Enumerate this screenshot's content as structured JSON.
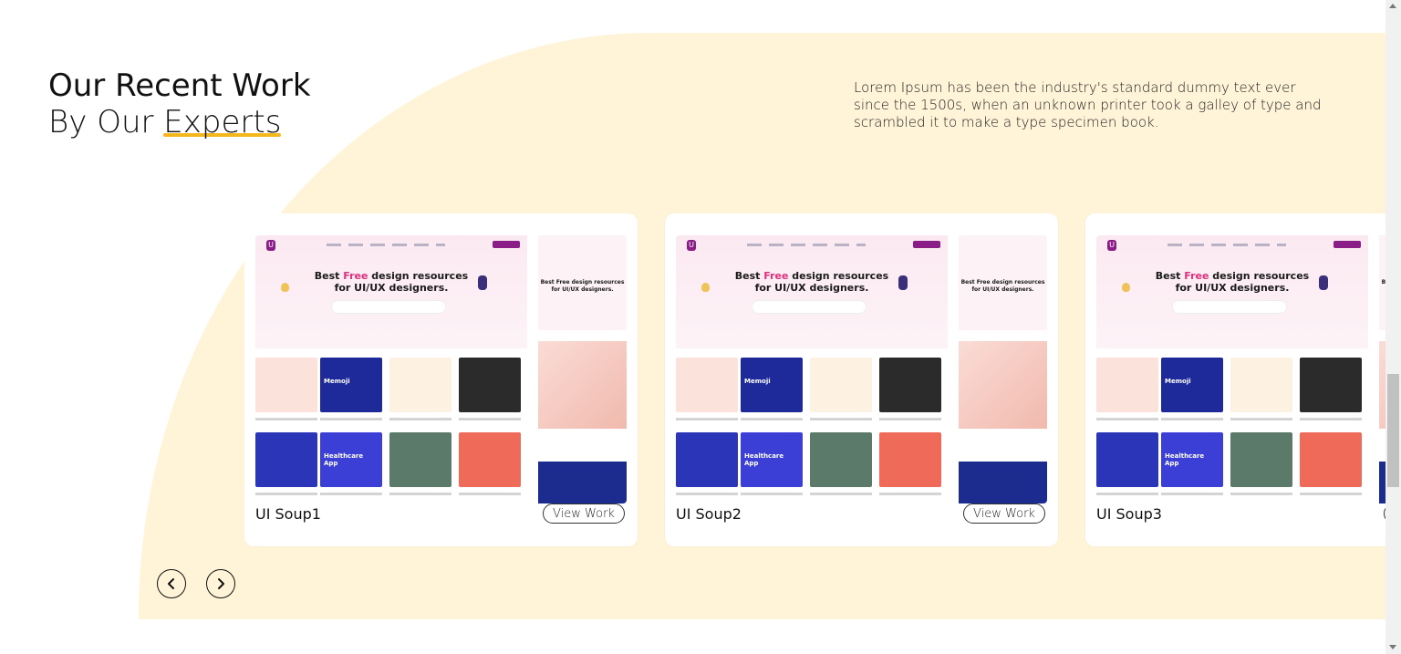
{
  "section": {
    "heading_line1": "Our Recent Work",
    "heading_line2_prefix": "By Our ",
    "heading_line2_accent": "Experts",
    "description": "Lorem Ipsum has been the industry's standard dummy text ever since the 1500s, when an unknown printer took a galley of type and scrambled it to make a type specimen book."
  },
  "colors": {
    "accent_yellow": "#f5b81c",
    "panel_background": "#fff4d8",
    "brand_purple": "#8a1e86",
    "pink_highlight": "#e0307d"
  },
  "preview": {
    "hero_title_before": "Best ",
    "hero_title_highlight": "Free",
    "hero_title_after": " design resources for UI/UX designers.",
    "side_title": "Best Free design resources for UI/UX designers.",
    "tiles": [
      {
        "label": "",
        "color": "#fbe3dc"
      },
      {
        "label": "Memoji",
        "color": "#1f2a9a"
      },
      {
        "label": "",
        "color": "#fdf1e2"
      },
      {
        "label": "",
        "color": "#2b2b2b"
      },
      {
        "label": "",
        "color": "#2a35b8"
      },
      {
        "label": "Healthcare App",
        "color": "#3b3fd6"
      },
      {
        "label": "",
        "color": "#5c7a6a"
      },
      {
        "label": "",
        "color": "#f06a5a"
      }
    ]
  },
  "cards": [
    {
      "title": "UI Soup1",
      "button": "View Work"
    },
    {
      "title": "UI Soup2",
      "button": "View Work"
    },
    {
      "title": "UI Soup3",
      "button": "View Work"
    }
  ],
  "controls": {
    "prev_icon": "chevron-left-icon",
    "next_icon": "chevron-right-icon"
  }
}
